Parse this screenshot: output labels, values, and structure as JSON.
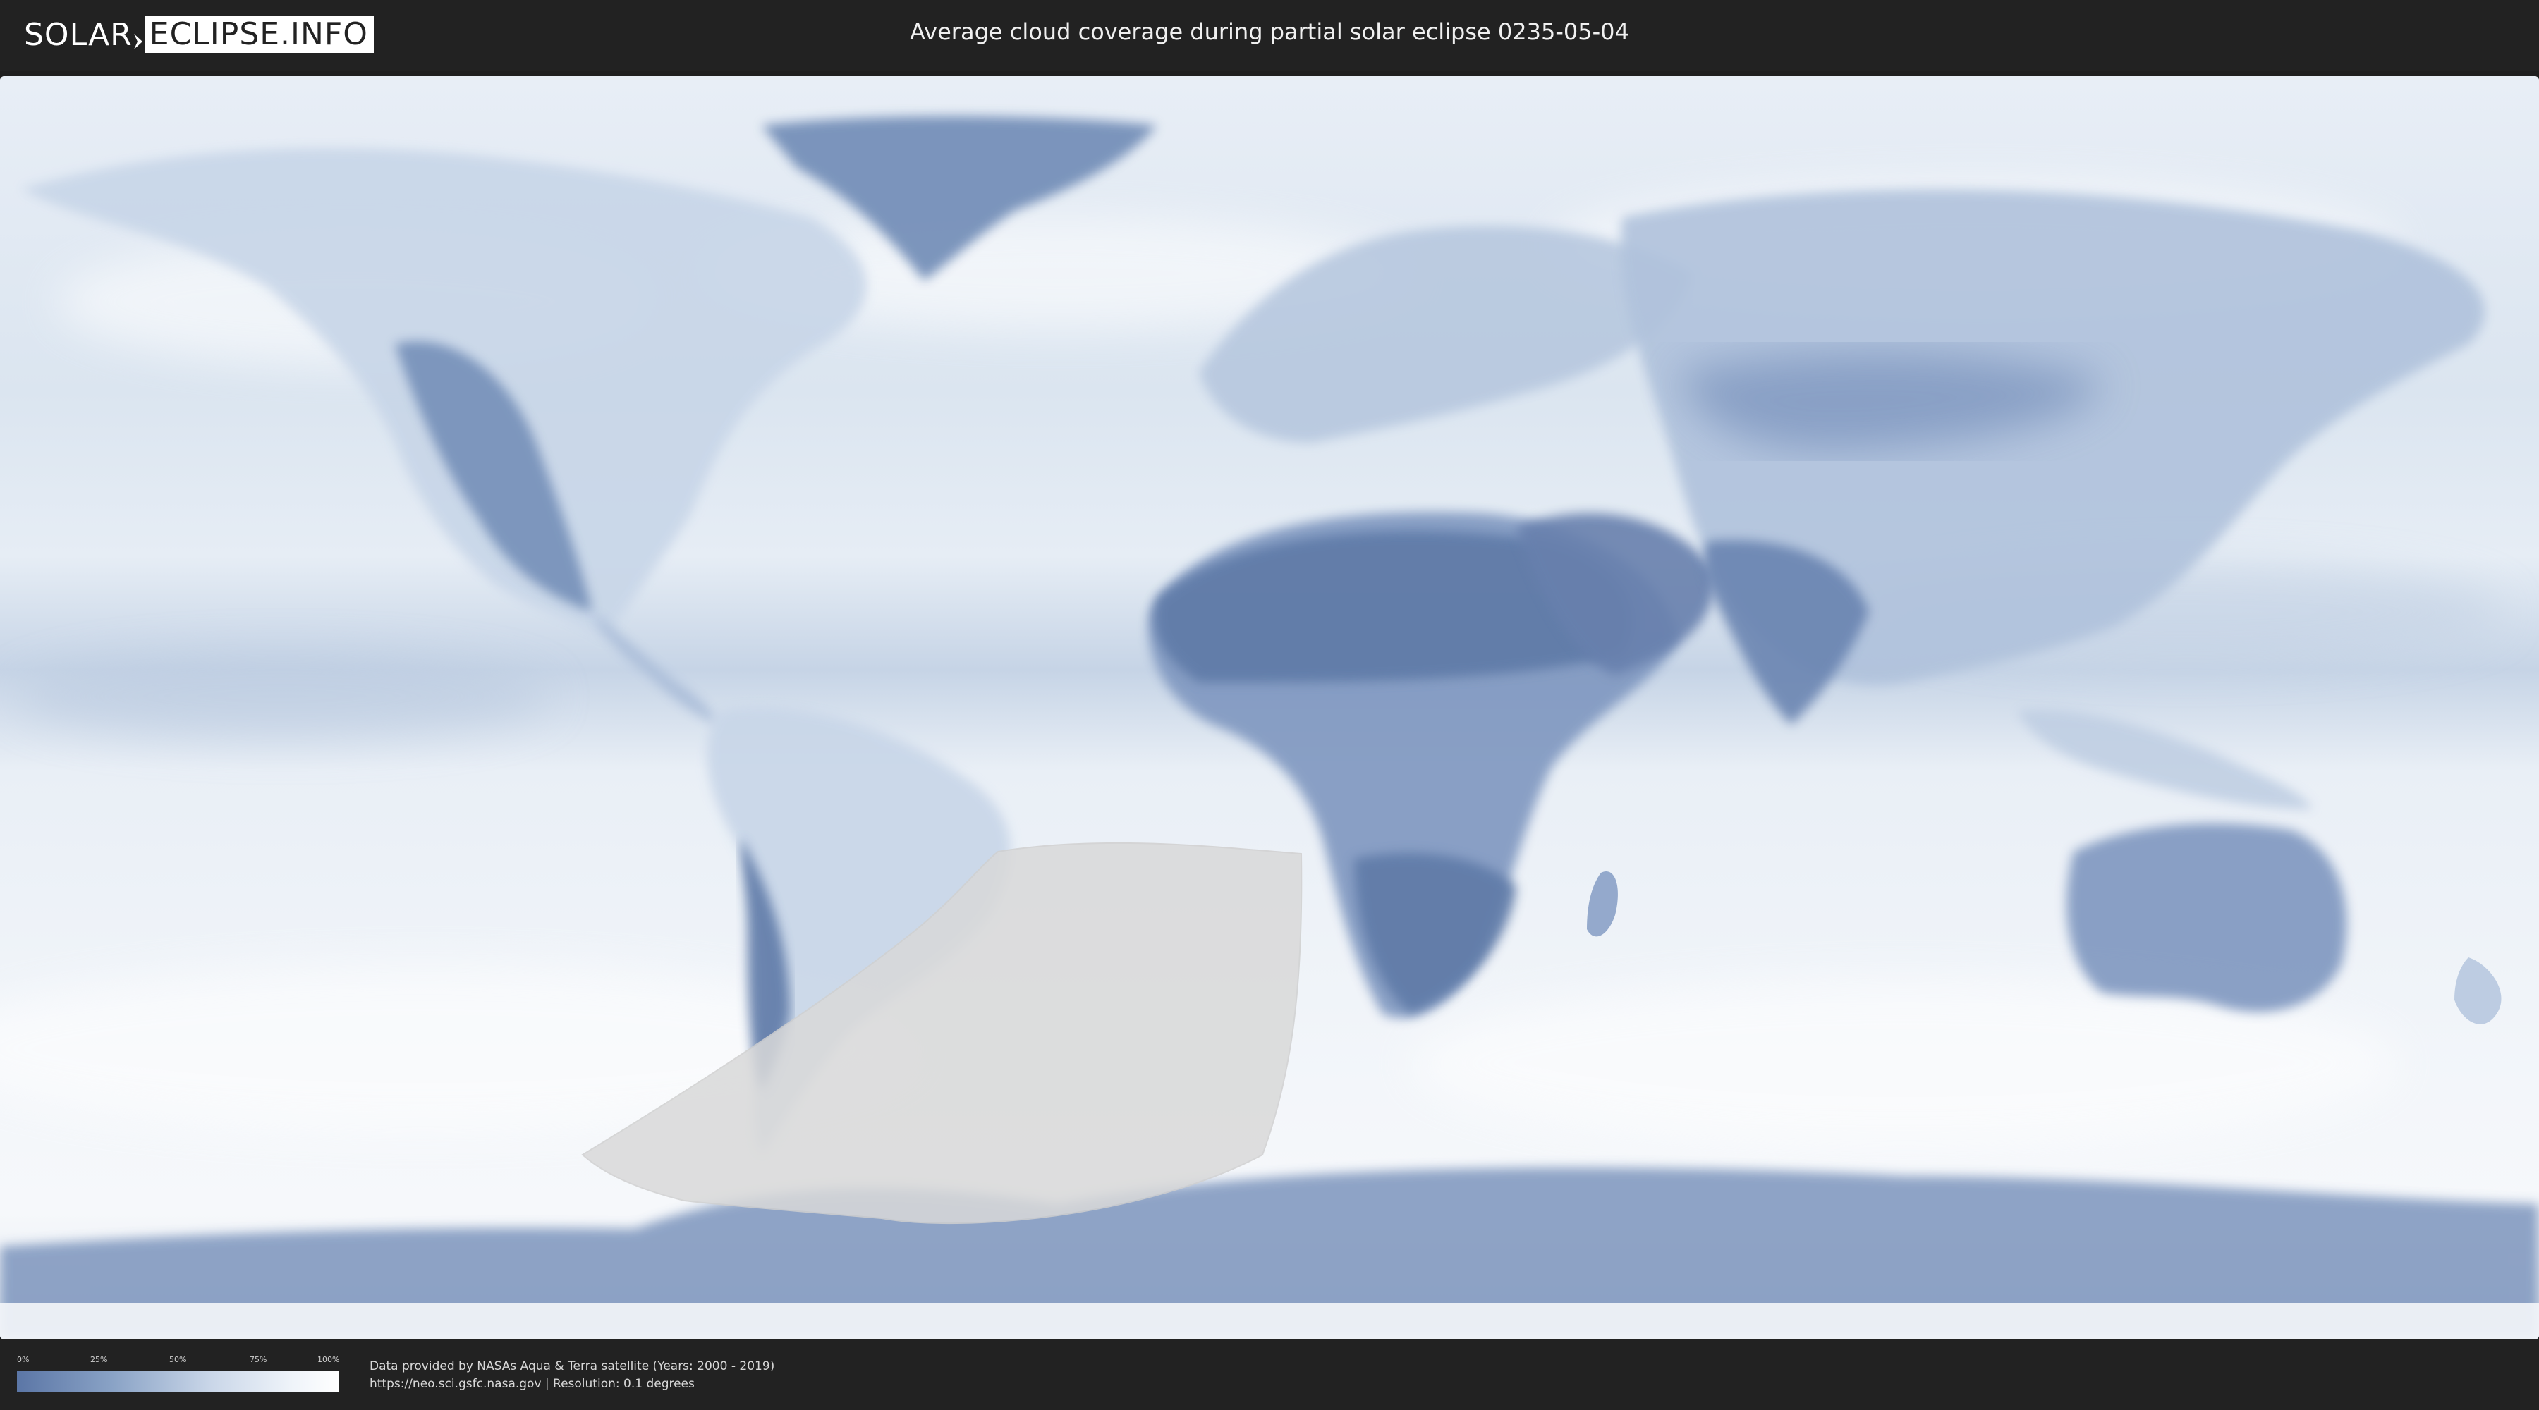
{
  "header": {
    "logo_left": "SOLAR",
    "logo_right": "ECLIPSE.INFO",
    "title": "Average cloud coverage during partial solar eclipse 0235-05-04"
  },
  "legend": {
    "ticks": [
      "0%",
      "25%",
      "50%",
      "75%",
      "100%"
    ],
    "low_color": "#5b76a6",
    "high_color": "#ffffff"
  },
  "credit": {
    "line1": "Data provided by NASAs Aqua & Terra satellite (Years: 2000 - 2019)",
    "line2": "https://neo.sci.gsfc.nasa.gov | Resolution: 0.1 degrees"
  },
  "colors": {
    "background": "#222222",
    "ocean_cloud": "#dfe8f2",
    "clear_land": "#6f8bb6",
    "eclipse_zone": "#d9d9d9"
  }
}
